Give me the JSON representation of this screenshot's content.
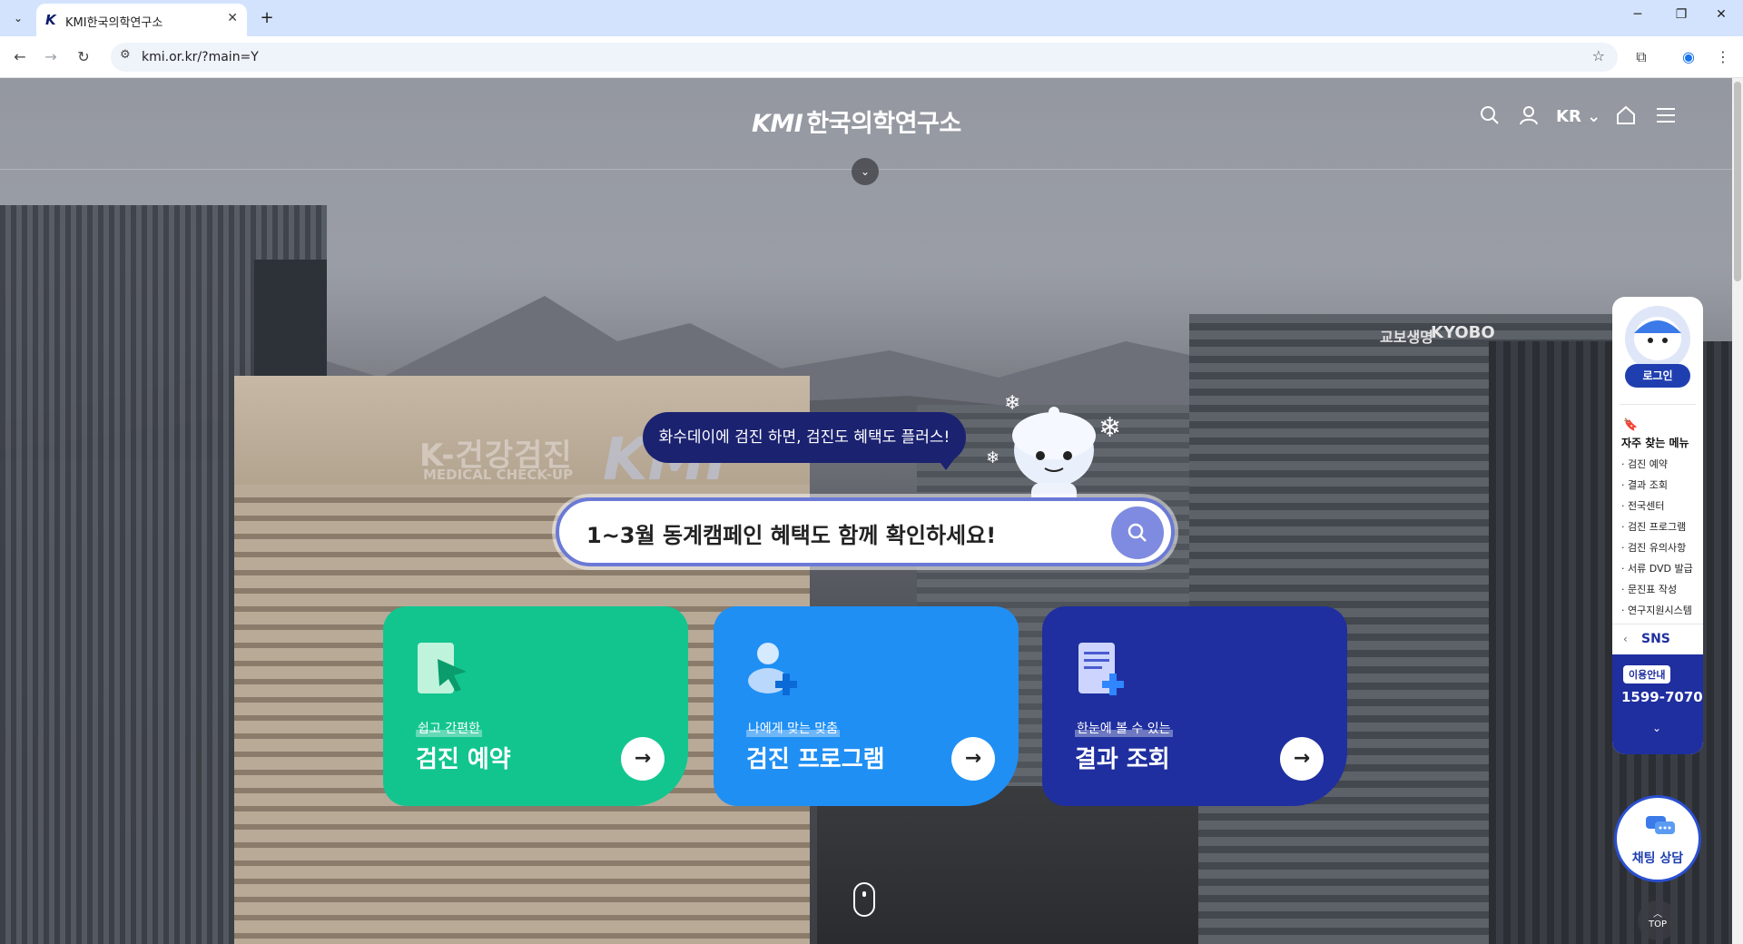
{
  "browser": {
    "tab_title": "KMI한국의학연구소",
    "tab_favicon": "K",
    "url": "kmi.or.kr/?main=Y",
    "new_tab_symbol": "+",
    "close_symbol": "✕"
  },
  "site": {
    "logo_mark": "KMI",
    "logo_text": "한국의학연구소",
    "lang": "KR",
    "bubble": "화수데이에 검진 하면, 검진도 혜택도 플러스!",
    "search_text": "1~3월 동계캠페인 혜택도 함께 확인하세요!",
    "building_text": "K-건강검진",
    "building_sub": "MEDICAL CHECK-UP",
    "building_kmi": "KMI",
    "kyobo_en": "KYOBO",
    "kyobo_kr": "교보생명"
  },
  "cards": [
    {
      "sub": "쉽고 간편한",
      "title": "검진 예약",
      "color": "#12c58f"
    },
    {
      "sub": "나에게 맞는 맞춤",
      "title": "검진 프로그램",
      "color": "#1f8ff4"
    },
    {
      "sub": "한눈에 볼 수 있는",
      "title": "결과 조회",
      "color": "#1f2fa0"
    }
  ],
  "quick": {
    "login": "로그인",
    "fav_title": "자주 찾는 메뉴",
    "items": [
      "· 검진 예약",
      "· 결과 조회",
      "· 전국센터",
      "· 검진 프로그램",
      "· 검진 유의사항",
      "· 서류 DVD 발급",
      "· 문진표 작성",
      "· 연구지원시스템"
    ],
    "sns": "SNS",
    "info_badge": "이용안내",
    "phone": "1599-7070",
    "chat": "채팅 상담",
    "top": "TOP"
  }
}
